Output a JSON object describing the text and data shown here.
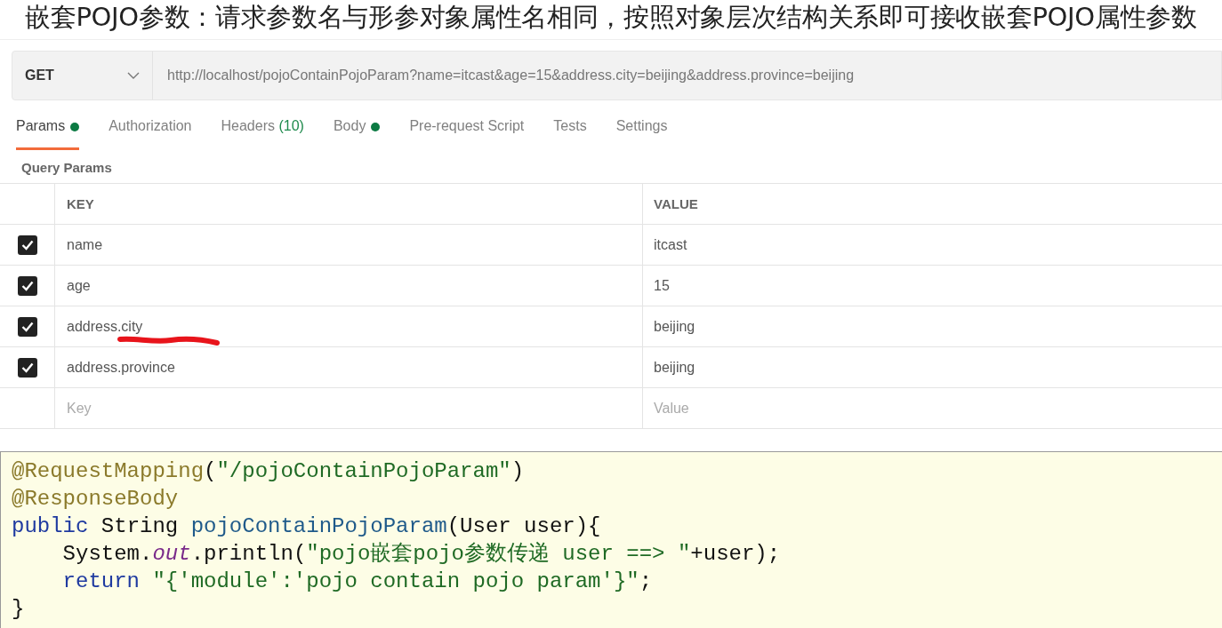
{
  "title": "嵌套POJO参数：请求参数名与形参对象属性名相同，按照对象层次结构关系即可接收嵌套POJO属性参数",
  "request": {
    "method": "GET",
    "url": "http://localhost/pojoContainPojoParam?name=itcast&age=15&address.city=beijing&address.province=beijing"
  },
  "tabs": [
    {
      "label": "Params",
      "dot": true,
      "selected": true
    },
    {
      "label": "Authorization",
      "dot": false,
      "selected": false
    },
    {
      "label": "Headers",
      "count": "(10)",
      "dot": false,
      "selected": false
    },
    {
      "label": "Body",
      "dot": true,
      "selected": false
    },
    {
      "label": "Pre-request Script",
      "dot": false,
      "selected": false
    },
    {
      "label": "Tests",
      "dot": false,
      "selected": false
    },
    {
      "label": "Settings",
      "dot": false,
      "selected": false
    }
  ],
  "section_title": "Query Params",
  "table": {
    "columns": [
      "KEY",
      "VALUE"
    ],
    "rows": [
      {
        "key": "name",
        "value": "itcast",
        "checked": true,
        "underlined": false
      },
      {
        "key": "age",
        "value": "15",
        "checked": true,
        "underlined": false
      },
      {
        "key": "address.city",
        "value": "beijing",
        "checked": true,
        "underlined": true
      },
      {
        "key": "address.province",
        "value": "beijing",
        "checked": true,
        "underlined": false
      }
    ],
    "new_row": {
      "key_placeholder": "Key",
      "value_placeholder": "Value"
    }
  },
  "code": [
    [
      {
        "kind": "annotation",
        "text": "@RequestMapping"
      },
      {
        "kind": "plain",
        "text": "("
      },
      {
        "kind": "string",
        "text": "\"/pojoContainPojoParam\""
      },
      {
        "kind": "plain",
        "text": ")"
      }
    ],
    [
      {
        "kind": "annotation",
        "text": "@ResponseBody"
      }
    ],
    [
      {
        "kind": "keyword",
        "text": "public"
      },
      {
        "kind": "plain",
        "text": " String "
      },
      {
        "kind": "method",
        "text": "pojoContainPojoParam"
      },
      {
        "kind": "plain",
        "text": "(User user){"
      }
    ],
    [
      {
        "kind": "plain",
        "text": "    System."
      },
      {
        "kind": "field",
        "text": "out"
      },
      {
        "kind": "plain",
        "text": ".println("
      },
      {
        "kind": "string",
        "text": "\"pojo嵌套pojo参数传递 user ==> \""
      },
      {
        "kind": "plain",
        "text": "+user);"
      }
    ],
    [
      {
        "kind": "keyword",
        "text": "    return"
      },
      {
        "kind": "string",
        "text": " \"{'module':'pojo contain pojo param'}\""
      },
      {
        "kind": "plain",
        "text": ";"
      }
    ],
    [
      {
        "kind": "plain",
        "text": "}"
      }
    ]
  ]
}
